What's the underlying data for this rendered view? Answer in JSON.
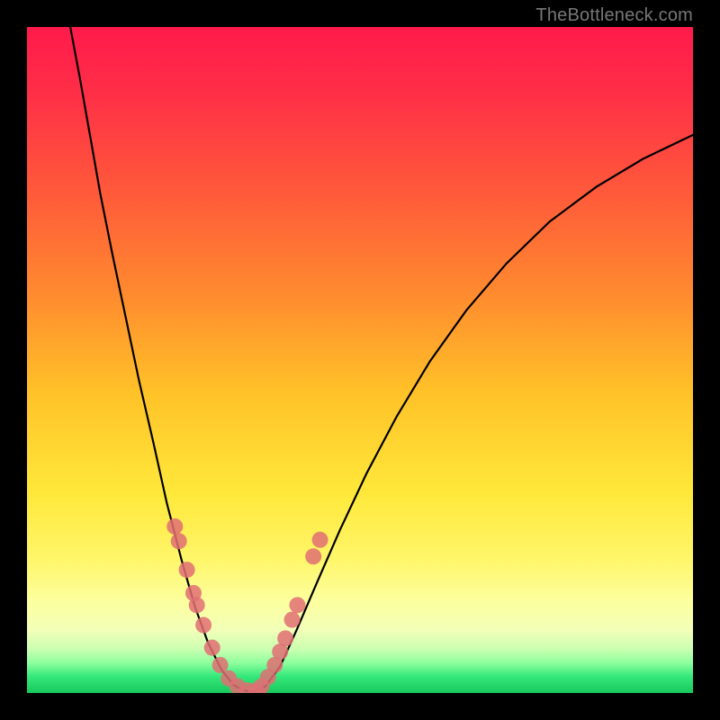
{
  "watermark": "TheBottleneck.com",
  "chart_data": {
    "type": "line",
    "title": "",
    "xlabel": "",
    "ylabel": "",
    "xlim": [
      0,
      1
    ],
    "ylim": [
      0,
      1
    ],
    "grid": false,
    "legend": false,
    "background_gradient_stops": [
      {
        "pos": 0.0,
        "color": "#ff1a4b"
      },
      {
        "pos": 0.1,
        "color": "#ff2f47"
      },
      {
        "pos": 0.25,
        "color": "#ff5a3a"
      },
      {
        "pos": 0.4,
        "color": "#ff8a2f"
      },
      {
        "pos": 0.55,
        "color": "#ffc228"
      },
      {
        "pos": 0.7,
        "color": "#ffe83a"
      },
      {
        "pos": 0.8,
        "color": "#fff66a"
      },
      {
        "pos": 0.86,
        "color": "#fcff9c"
      },
      {
        "pos": 0.905,
        "color": "#f3ffb8"
      },
      {
        "pos": 0.935,
        "color": "#c9ffb0"
      },
      {
        "pos": 0.955,
        "color": "#8dff9d"
      },
      {
        "pos": 0.975,
        "color": "#35e87a"
      },
      {
        "pos": 1.0,
        "color": "#18c95e"
      }
    ],
    "series": [
      {
        "name": "left-branch",
        "type": "line",
        "color": "#000000",
        "points": [
          {
            "x": 0.065,
            "y": 1.0
          },
          {
            "x": 0.08,
            "y": 0.92
          },
          {
            "x": 0.095,
            "y": 0.835
          },
          {
            "x": 0.11,
            "y": 0.75
          },
          {
            "x": 0.128,
            "y": 0.66
          },
          {
            "x": 0.148,
            "y": 0.565
          },
          {
            "x": 0.168,
            "y": 0.47
          },
          {
            "x": 0.19,
            "y": 0.375
          },
          {
            "x": 0.21,
            "y": 0.285
          },
          {
            "x": 0.232,
            "y": 0.2
          },
          {
            "x": 0.252,
            "y": 0.13
          },
          {
            "x": 0.272,
            "y": 0.075
          },
          {
            "x": 0.292,
            "y": 0.035
          },
          {
            "x": 0.31,
            "y": 0.012
          },
          {
            "x": 0.325,
            "y": 0.004
          },
          {
            "x": 0.34,
            "y": 0.002
          }
        ]
      },
      {
        "name": "right-branch",
        "type": "line",
        "color": "#000000",
        "points": [
          {
            "x": 0.34,
            "y": 0.002
          },
          {
            "x": 0.358,
            "y": 0.01
          },
          {
            "x": 0.38,
            "y": 0.04
          },
          {
            "x": 0.405,
            "y": 0.095
          },
          {
            "x": 0.435,
            "y": 0.165
          },
          {
            "x": 0.47,
            "y": 0.245
          },
          {
            "x": 0.51,
            "y": 0.33
          },
          {
            "x": 0.555,
            "y": 0.415
          },
          {
            "x": 0.605,
            "y": 0.498
          },
          {
            "x": 0.66,
            "y": 0.575
          },
          {
            "x": 0.72,
            "y": 0.645
          },
          {
            "x": 0.785,
            "y": 0.708
          },
          {
            "x": 0.855,
            "y": 0.76
          },
          {
            "x": 0.925,
            "y": 0.802
          },
          {
            "x": 1.0,
            "y": 0.838
          }
        ]
      },
      {
        "name": "left-dots",
        "type": "scatter",
        "color": "#e06f73",
        "radius": 9,
        "points": [
          {
            "x": 0.222,
            "y": 0.25
          },
          {
            "x": 0.228,
            "y": 0.228
          },
          {
            "x": 0.24,
            "y": 0.185
          },
          {
            "x": 0.25,
            "y": 0.15
          },
          {
            "x": 0.255,
            "y": 0.132
          },
          {
            "x": 0.265,
            "y": 0.102
          },
          {
            "x": 0.278,
            "y": 0.068
          },
          {
            "x": 0.29,
            "y": 0.042
          },
          {
            "x": 0.303,
            "y": 0.022
          },
          {
            "x": 0.316,
            "y": 0.01
          },
          {
            "x": 0.33,
            "y": 0.004
          }
        ]
      },
      {
        "name": "right-dots",
        "type": "scatter",
        "color": "#e06f73",
        "radius": 9,
        "points": [
          {
            "x": 0.344,
            "y": 0.004
          },
          {
            "x": 0.352,
            "y": 0.01
          },
          {
            "x": 0.362,
            "y": 0.024
          },
          {
            "x": 0.372,
            "y": 0.042
          },
          {
            "x": 0.38,
            "y": 0.062
          },
          {
            "x": 0.388,
            "y": 0.082
          },
          {
            "x": 0.398,
            "y": 0.11
          },
          {
            "x": 0.406,
            "y": 0.132
          },
          {
            "x": 0.43,
            "y": 0.205
          },
          {
            "x": 0.44,
            "y": 0.23
          }
        ]
      }
    ]
  }
}
